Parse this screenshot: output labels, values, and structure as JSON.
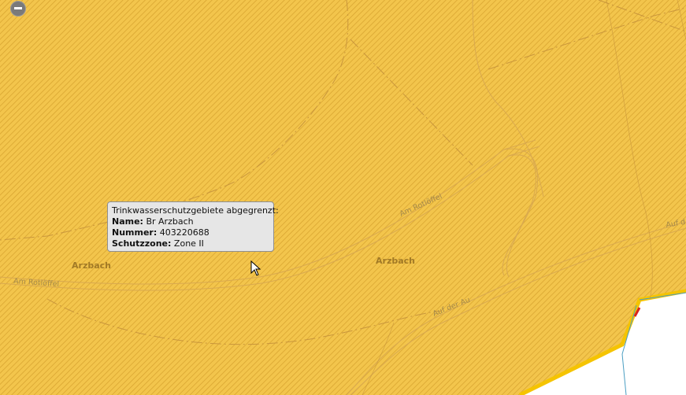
{
  "map": {
    "colors": {
      "zone_fill": "#f3c54c",
      "zone_hatch": "#d9a530",
      "zone_border": "#f5c400",
      "outside": "#ffffff",
      "road": "#d9a94f",
      "parcel_line": "#c9963c",
      "water_line": "#4a9ec2",
      "marker": "#d8231f"
    },
    "place_labels": [
      "Arzbach",
      "Arzbach"
    ],
    "street_labels": [
      "Am Rotlöffel",
      "Am Rotlöffel",
      "Auf der Au",
      "Auf d"
    ]
  },
  "controls": {
    "zoom_out_icon": "minus-icon"
  },
  "tooltip": {
    "title": "Trinkwasserschutzgebiete abgegrenzt:",
    "name_label": "Name:",
    "name_value": "Br Arzbach",
    "number_label": "Nummer:",
    "number_value": "403220688",
    "zone_label": "Schutzzone:",
    "zone_value": "Zone II"
  },
  "cursor": {
    "icon": "arrow-cursor-icon"
  }
}
